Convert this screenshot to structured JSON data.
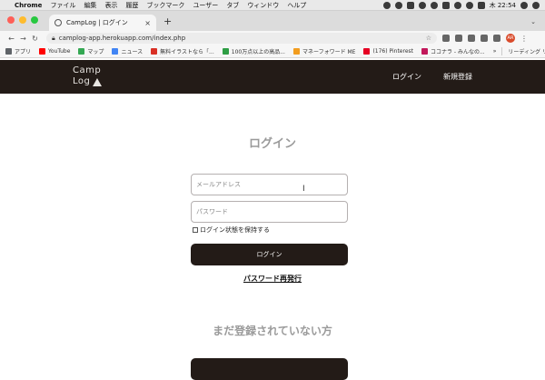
{
  "menubar": {
    "app_name": "Chrome",
    "items": [
      "ファイル",
      "編集",
      "表示",
      "履歴",
      "ブックマーク",
      "ユーザー",
      "タブ",
      "ウィンドウ",
      "ヘルプ"
    ],
    "clock": "木 22:54"
  },
  "tab": {
    "title": "CampLog | ログイン"
  },
  "address_bar": {
    "url": "camplog-app.herokuapp.com/index.php",
    "avatar_initials": "AR"
  },
  "bookmarks": {
    "items": [
      {
        "label": "アプリ",
        "icon": "apps-grid-icon",
        "color": "#5f6368"
      },
      {
        "label": "YouTube",
        "icon": "youtube-icon",
        "color": "#ff0000"
      },
      {
        "label": "マップ",
        "icon": "maps-pin-icon",
        "color": "#34a853"
      },
      {
        "label": "ニュース",
        "icon": "news-icon",
        "color": "#4285f4"
      },
      {
        "label": "無料イラストなら「...",
        "icon": "a-logo-icon",
        "color": "#d93025"
      },
      {
        "label": "100万点以上の高品...",
        "icon": "green-square-icon",
        "color": "#2e9e44"
      },
      {
        "label": "マネーフォワード ME",
        "icon": "moneyforward-icon",
        "color": "#f29d1f"
      },
      {
        "label": "(176) Pinterest",
        "icon": "pinterest-icon",
        "color": "#e60023"
      },
      {
        "label": "ココナラ - みんなの...",
        "icon": "coconala-icon",
        "color": "#c2185b"
      }
    ],
    "more": "»",
    "reading_list": "リーディング リスト"
  },
  "site": {
    "logo_line1": "Camp",
    "logo_line2": "Log",
    "nav_login": "ログイン",
    "nav_signup": "新規登録"
  },
  "login_form": {
    "title": "ログイン",
    "email_placeholder": "メールアドレス",
    "password_placeholder": "パスワード",
    "remember_label": "ログイン状態を保持する",
    "submit_label": "ログイン",
    "forgot_label": "パスワード再発行"
  },
  "register_section": {
    "title": "まだ登録されていない方"
  },
  "colors": {
    "header_bg": "#231b17",
    "button_bg": "#231b17",
    "heading_gray": "#9a9a9a"
  }
}
